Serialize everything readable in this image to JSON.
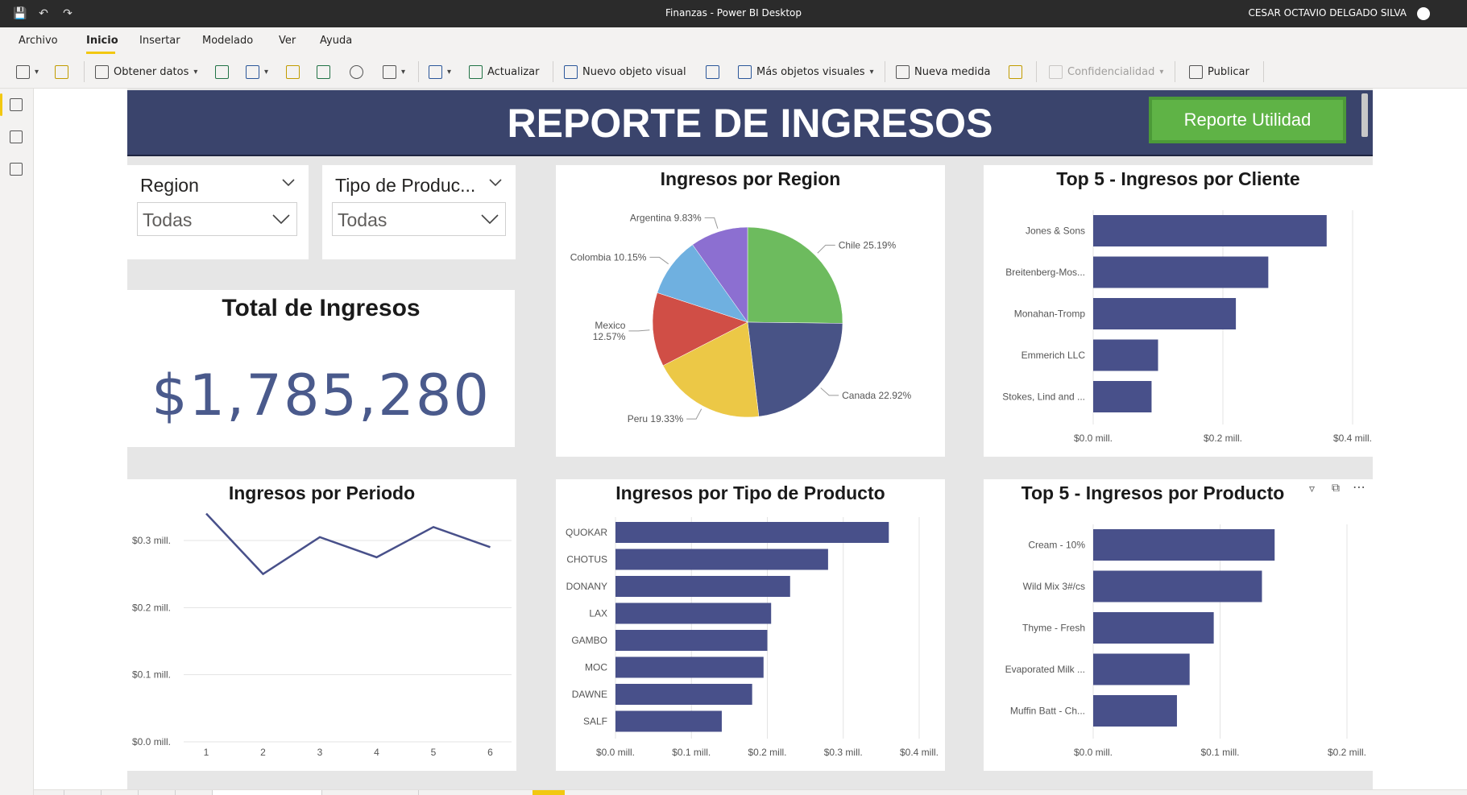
{
  "window": {
    "title": "Finanzas - Power BI Desktop",
    "user": "CESAR OCTAVIO DELGADO SILVA"
  },
  "menu": [
    "Archivo",
    "Inicio",
    "Insertar",
    "Modelado",
    "Ver",
    "Ayuda"
  ],
  "menu_active": "Inicio",
  "ribbon": {
    "get_data": "Obtener datos",
    "refresh": "Actualizar",
    "new_visual": "Nuevo objeto visual",
    "more_visuals": "Más objetos visuales",
    "new_measure": "Nueva medida",
    "sensitivity": "Confidencialidad",
    "publish": "Publicar"
  },
  "report": {
    "header_title": "REPORTE DE INGRESOS",
    "header_button": "Reporte Utilidad",
    "slicer_region": {
      "label": "Region",
      "value": "Todas"
    },
    "slicer_product": {
      "label": "Tipo de Produc...",
      "value": "Todas"
    },
    "kpi": {
      "title": "Total de Ingresos",
      "value": "$1,785,280"
    },
    "colors": {
      "header": "#3a446c",
      "bar": "#48508a",
      "button": "#5fb346"
    }
  },
  "chart_data": [
    {
      "id": "pie",
      "type": "pie",
      "title": "Ingresos por Region",
      "labels": [
        "Chile",
        "Canada",
        "Peru",
        "Mexico",
        "Colombia",
        "Argentina"
      ],
      "values": [
        25.19,
        22.92,
        19.33,
        12.57,
        10.15,
        9.83
      ],
      "display_labels": [
        "Chile 25.19%",
        "Canada 22.92%",
        "Peru 19.33%",
        "Mexico 12.57%",
        "Colombia 10.15%",
        "Argentina 9.83%"
      ],
      "colors": [
        "#6dbb5e",
        "#485386",
        "#ecc846",
        "#d04e46",
        "#6fb0e0",
        "#8c6fd1"
      ]
    },
    {
      "id": "clients",
      "type": "bar",
      "orientation": "horizontal",
      "title": "Top 5 - Ingresos por Cliente",
      "categories": [
        "Jones & Sons",
        "Breitenberg-Mos...",
        "Monahan-Tromp",
        "Emmerich LLC",
        "Stokes, Lind and ..."
      ],
      "values": [
        0.36,
        0.27,
        0.22,
        0.1,
        0.09
      ],
      "xticks": [
        "$0.0 mill.",
        "$0.2 mill.",
        "$0.4 mill."
      ],
      "xlim": [
        0,
        0.4
      ]
    },
    {
      "id": "period",
      "type": "line",
      "title": "Ingresos por Periodo",
      "x": [
        1,
        2,
        3,
        4,
        5,
        6
      ],
      "values": [
        0.34,
        0.25,
        0.305,
        0.275,
        0.32,
        0.29
      ],
      "yticks": [
        "$0.0 mill.",
        "$0.1 mill.",
        "$0.2 mill.",
        "$0.3 mill."
      ],
      "xticks": [
        "1",
        "2",
        "3",
        "4",
        "5",
        "6"
      ],
      "ylim": [
        0,
        0.3
      ],
      "grid": true
    },
    {
      "id": "product_type",
      "type": "bar",
      "orientation": "horizontal",
      "title": "Ingresos por Tipo de Producto",
      "categories": [
        "QUOKAR",
        "CHOTUS",
        "DONANY",
        "LAX",
        "GAMBO",
        "MOC",
        "DAWNE",
        "SALF"
      ],
      "values": [
        0.36,
        0.28,
        0.23,
        0.205,
        0.2,
        0.195,
        0.18,
        0.14
      ],
      "xticks": [
        "$0.0 mill.",
        "$0.1 mill.",
        "$0.2 mill.",
        "$0.3 mill.",
        "$0.4 mill."
      ],
      "xlim": [
        0,
        0.4
      ]
    },
    {
      "id": "products",
      "type": "bar",
      "orientation": "horizontal",
      "title": "Top 5 - Ingresos por Producto",
      "categories": [
        "Cream - 10%",
        "Wild Mix 3#/cs",
        "Thyme - Fresh",
        "Evaporated Milk ...",
        "Muffin Batt - Ch..."
      ],
      "values": [
        0.143,
        0.133,
        0.095,
        0.076,
        0.066
      ],
      "xticks": [
        "$0.0 mill.",
        "$0.1 mill.",
        "$0.2 mill."
      ],
      "xlim": [
        0,
        0.2
      ]
    }
  ]
}
